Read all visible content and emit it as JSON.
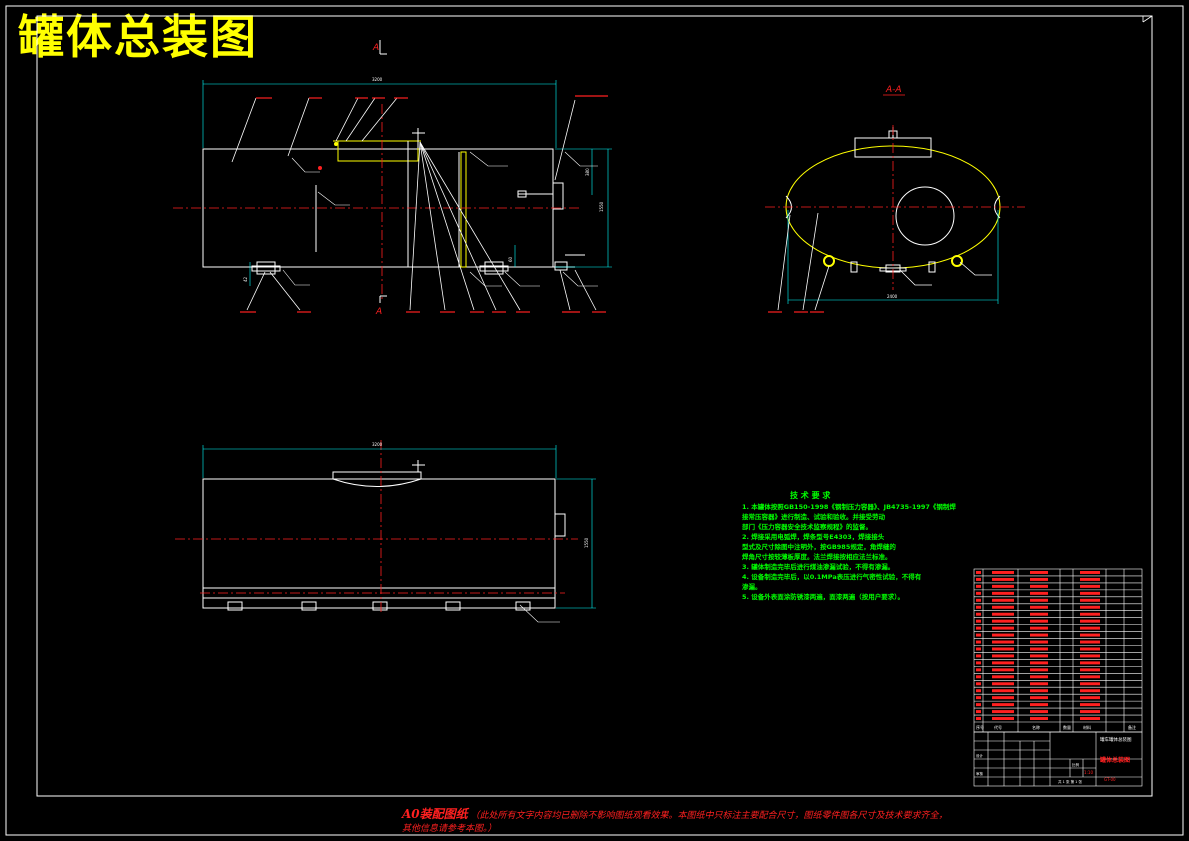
{
  "title": "罐体总装图",
  "section_label_top": "A",
  "section_label_bottom": "A",
  "section_view_label": "A-A",
  "dims": {
    "front_length": "3200",
    "front_height": "1550",
    "front_nozzle": "380",
    "front_left": "42",
    "front_small": "60",
    "side_width": "2400",
    "top_length": "3200",
    "top_height": "1550"
  },
  "tech_req": {
    "heading": "技 术 要 求",
    "lines": [
      "1. 本罐体按照GB150-1998《钢制压力容器》、JB4735-1997《钢制焊",
      "   接常压容器》进行制造、试验和验收。并接受劳动",
      "   部门《压力容器安全技术监察规程》的监督。",
      "2. 焊接采用电弧焊，焊条型号E4303，焊接接头",
      "   型式及尺寸除图中注明外，按GB985规定，角焊缝的",
      "   焊角尺寸按较薄板厚度。法兰焊接按相应法兰标准。",
      "3. 罐体制造完毕后进行煤油渗漏试验，不得有渗漏。",
      "4. 设备制造完毕后，以0.1MPa表压进行气密性试验，不得有",
      "   渗漏。",
      "5. 设备外表面涂防锈漆两遍，面漆两遍（按用户要求）。"
    ]
  },
  "bom": {
    "rows": 22,
    "header": [
      "序号",
      "代号",
      "名称",
      "数量",
      "材料",
      "备注"
    ]
  },
  "titleblock": {
    "project": "罐车罐体总装图",
    "drawing_name": "罐体总装图",
    "scale_label": "比例",
    "scale": "1:10",
    "sheet": "共 1 张  第 1 张",
    "code": "GT-00",
    "designer": "设计",
    "checker": "审核"
  },
  "note": {
    "main": "A0装配图纸",
    "line1": "（此处所有文字内容均已删除不影响图纸观看效果。本图纸中只标注主要配合尺寸，图纸零件图各尺寸及技术要求齐全，",
    "line2": "其他信息请参考本图。）"
  }
}
